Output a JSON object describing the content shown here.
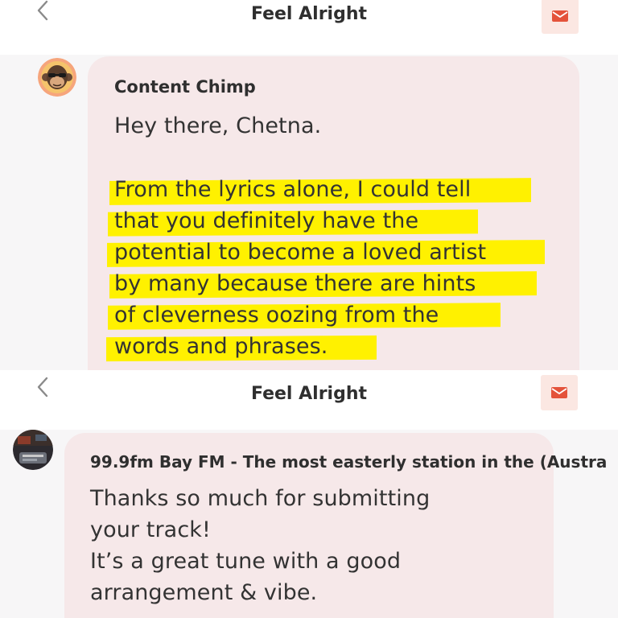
{
  "screens": [
    {
      "header": {
        "title": "Feel Alright",
        "back_icon": "chevron-left-icon",
        "mail_icon": "envelope-icon"
      },
      "sender": "Content Chimp",
      "greeting": "Hey there, Chetna.",
      "body_lines": [
        "From the lyrics alone, I could tell",
        "that you definitely have the",
        "potential to become a loved artist",
        "by many because there are hints",
        "of cleverness oozing from the",
        "words and phrases."
      ],
      "highlighted": true
    },
    {
      "header": {
        "title": "Feel Alright",
        "back_icon": "chevron-left-icon",
        "mail_icon": "envelope-icon"
      },
      "sender": "99.9fm Bay FM - The most easterly station in the (Austra",
      "body_lines": [
        "Thanks so much for submitting",
        "your track!",
        "It’s a great tune with a good",
        "arrangement & vibe."
      ]
    }
  ],
  "colors": {
    "accent": "#e4533b",
    "bubble": "#f6e8e9",
    "highlight": "#fff100",
    "mail_button_bg": "#fbe7e2"
  }
}
